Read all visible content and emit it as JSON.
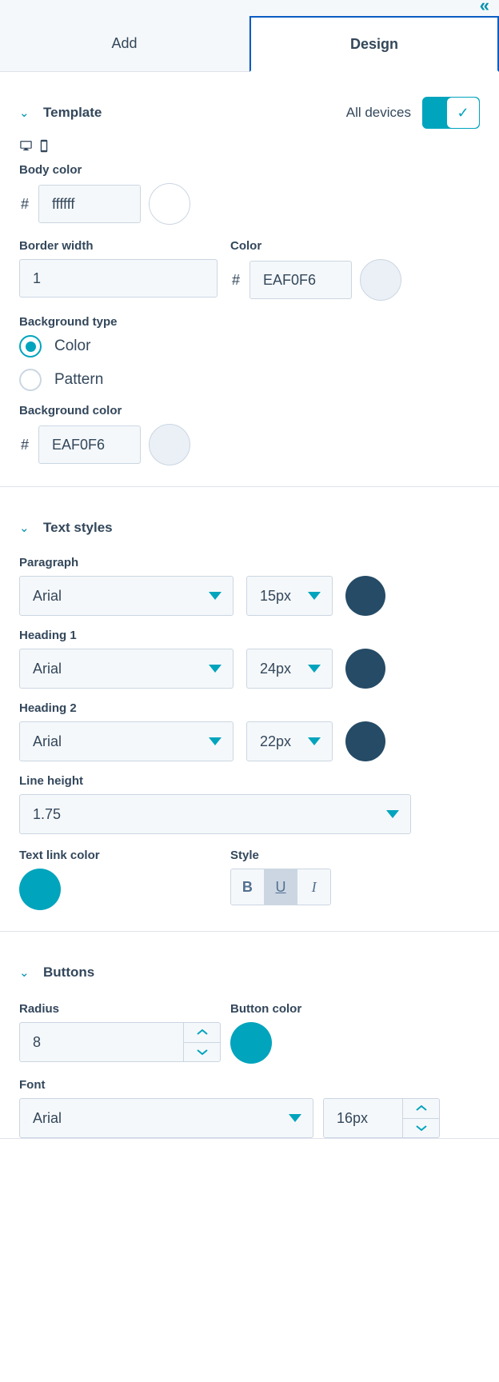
{
  "topbar": {
    "collapse_icon": "«"
  },
  "tabs": [
    {
      "label": "Add",
      "active": false
    },
    {
      "label": "Design",
      "active": true
    }
  ],
  "template_section": {
    "title": "Template",
    "chevron": "⌄",
    "toggle": {
      "label": "All devices",
      "checked": true,
      "check_glyph": "✓",
      "on_color": "#00a4bd"
    },
    "devices": [
      "desktop-icon",
      "mobile-icon"
    ],
    "body_color": {
      "label": "Body color",
      "hash": "#",
      "value": "ffffff",
      "swatch_color": "#ffffff"
    },
    "border_width": {
      "label": "Border width",
      "value": "1"
    },
    "border_color": {
      "label": "Color",
      "hash": "#",
      "value": "EAF0F6",
      "swatch_color": "#EAF0F6"
    },
    "background_type": {
      "label": "Background type",
      "options": [
        {
          "label": "Color",
          "selected": true
        },
        {
          "label": "Pattern",
          "selected": false
        }
      ]
    },
    "background_color": {
      "label": "Background color",
      "hash": "#",
      "value": "EAF0F6",
      "swatch_color": "#EAF0F6"
    }
  },
  "text_styles_section": {
    "title": "Text styles",
    "chevron": "⌄",
    "styles": [
      {
        "label": "Paragraph",
        "font": "Arial",
        "size": "15px",
        "color": "#254b66"
      },
      {
        "label": "Heading 1",
        "font": "Arial",
        "size": "24px",
        "color": "#254b66"
      },
      {
        "label": "Heading 2",
        "font": "Arial",
        "size": "22px",
        "color": "#254b66"
      }
    ],
    "line_height": {
      "label": "Line height",
      "value": "1.75"
    },
    "text_link_color": {
      "label": "Text link color",
      "color": "#00a4bd"
    },
    "style": {
      "label": "Style",
      "buttons": [
        {
          "label": "B",
          "name": "bold",
          "active": false
        },
        {
          "label": "U",
          "name": "underline",
          "active": true
        },
        {
          "label": "I",
          "name": "italic",
          "active": false
        }
      ]
    }
  },
  "buttons_section": {
    "title": "Buttons",
    "chevron": "⌄",
    "radius": {
      "label": "Radius",
      "value": "8"
    },
    "button_color": {
      "label": "Button color",
      "color": "#00a4bd"
    },
    "font": {
      "label": "Font",
      "family": "Arial",
      "size": "16px"
    }
  }
}
